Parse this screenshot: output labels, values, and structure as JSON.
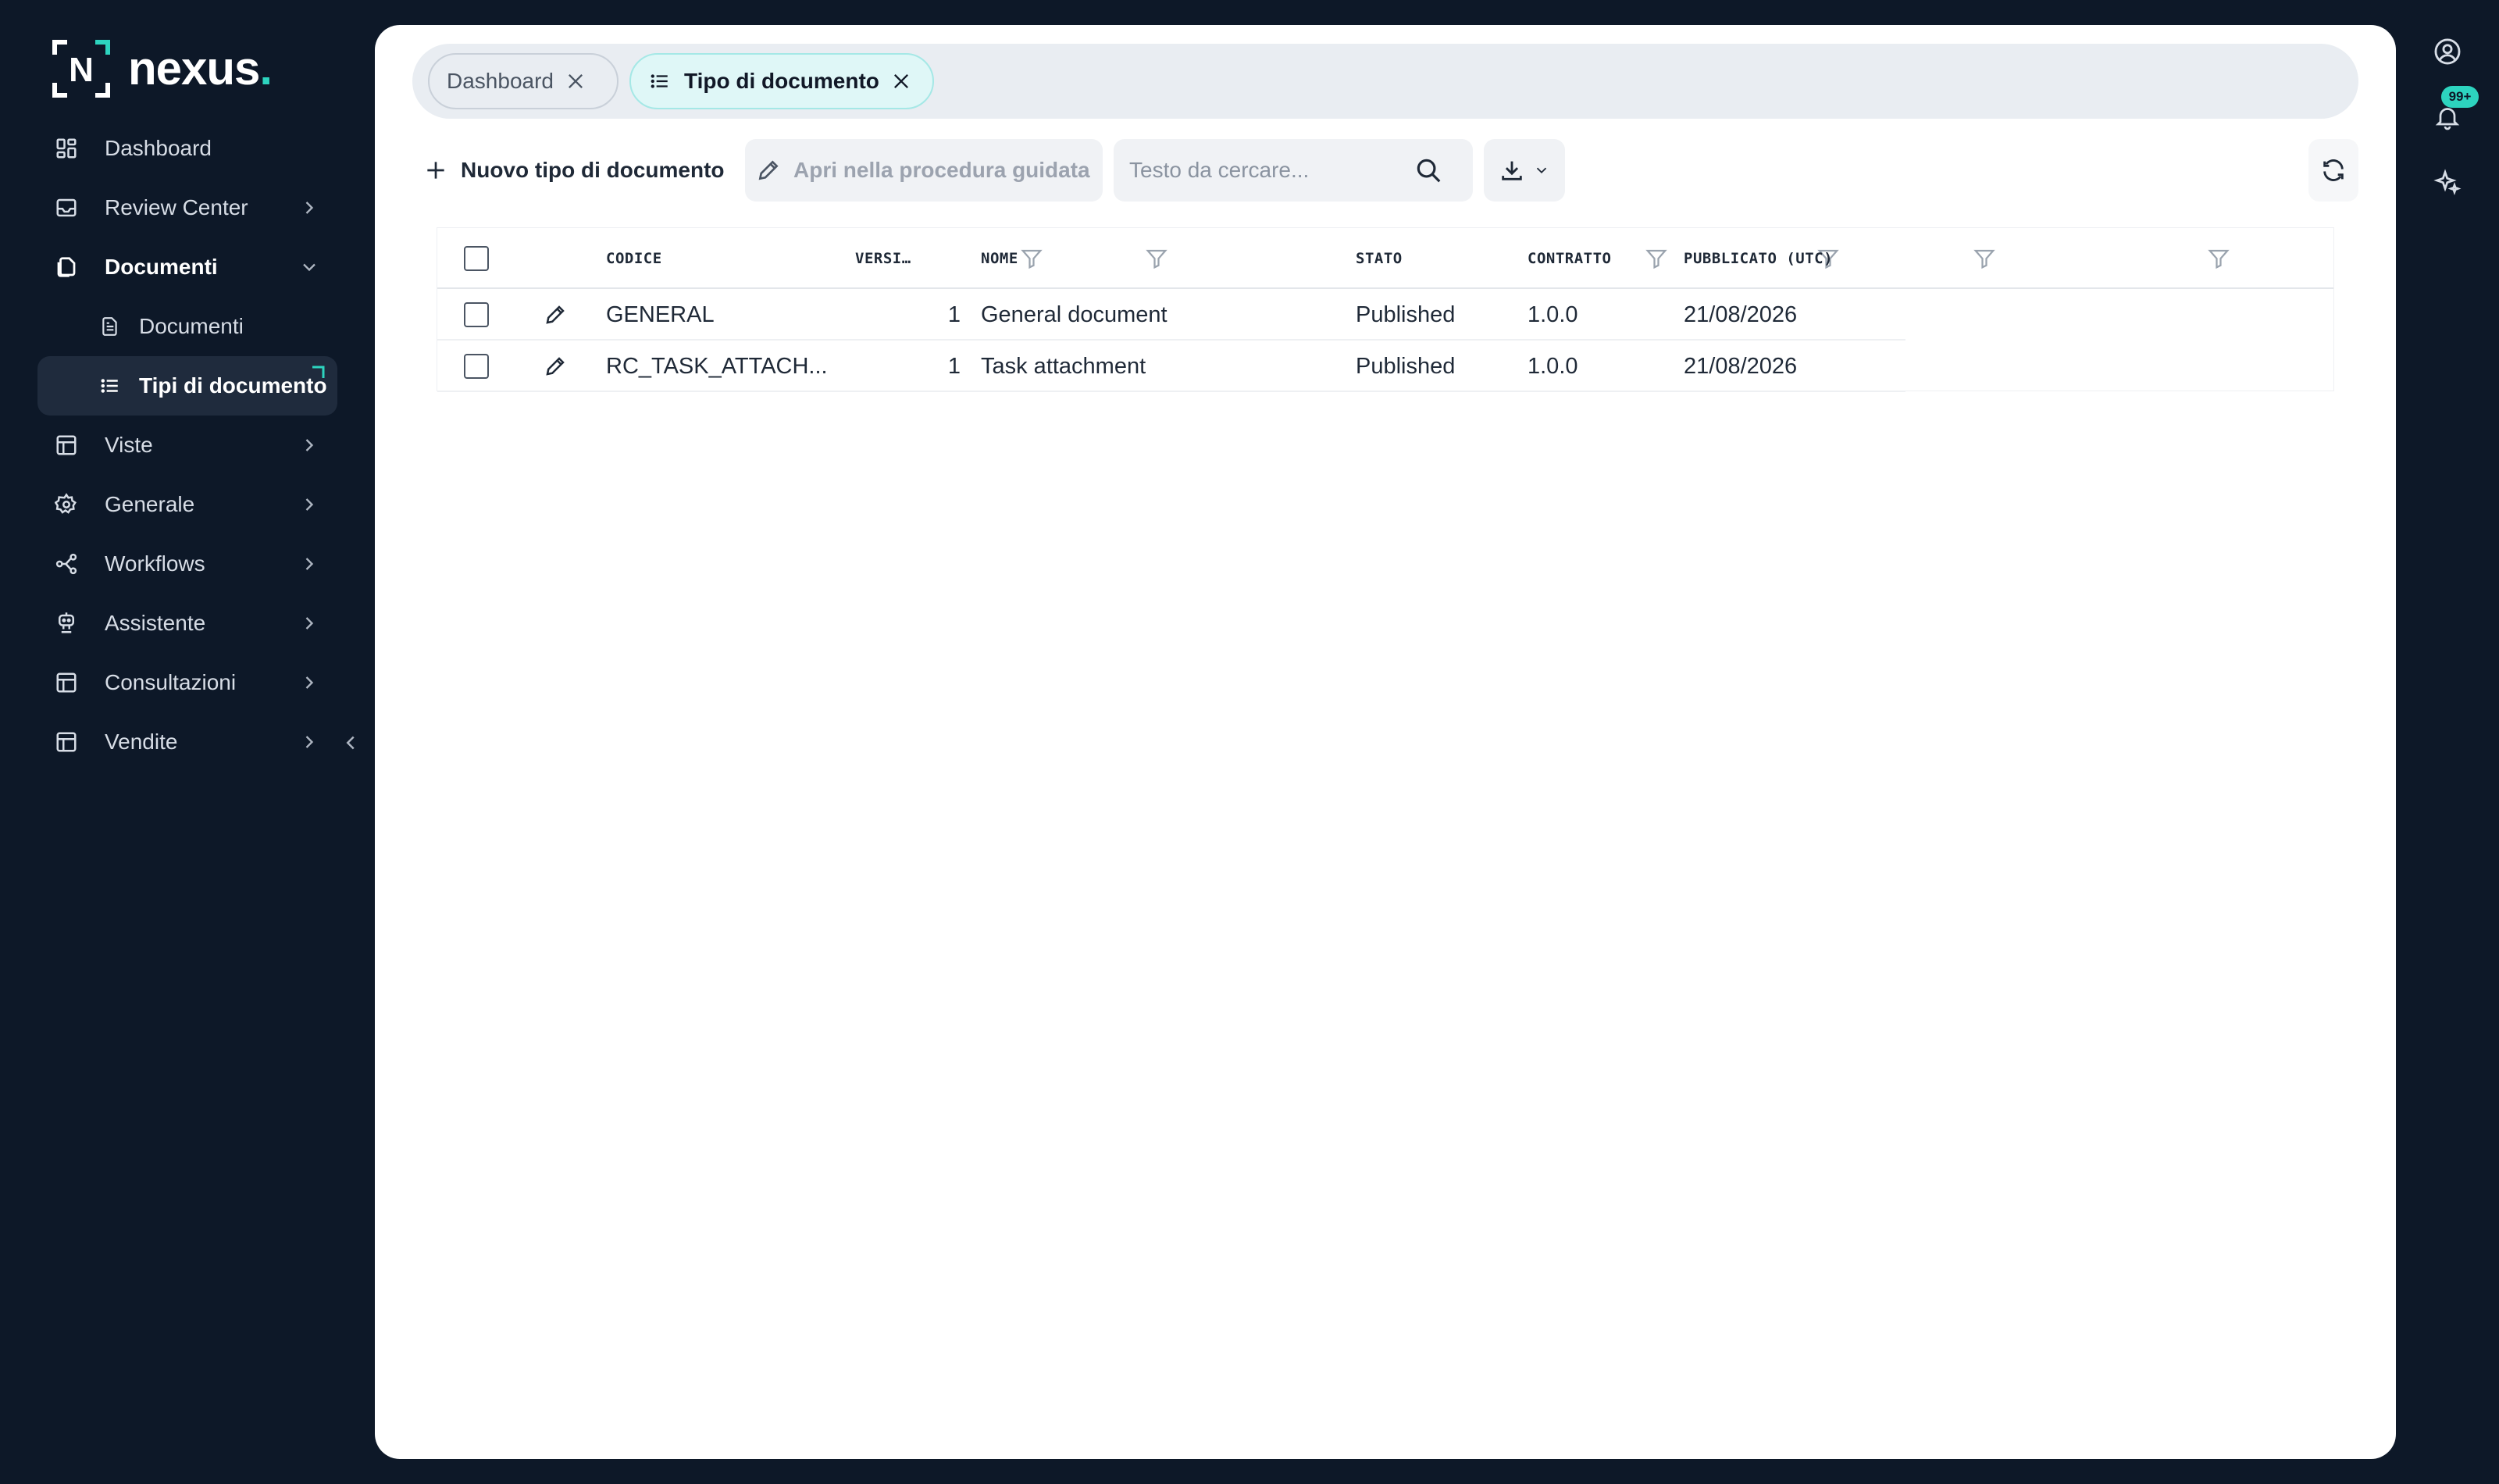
{
  "brand": {
    "name": "nexus",
    "dot": ".",
    "mark_letter": "N",
    "accent": "#2dd4bf"
  },
  "sidebar": {
    "items": [
      {
        "label": "Dashboard",
        "icon": "dashboard-grid-icon",
        "has_chevron": false
      },
      {
        "label": "Review Center",
        "icon": "inbox-icon",
        "has_chevron": true
      },
      {
        "label": "Documenti",
        "icon": "documents-icon",
        "has_chevron": true,
        "expanded": true
      },
      {
        "label": "Viste",
        "icon": "table-icon",
        "has_chevron": true
      },
      {
        "label": "Generale",
        "icon": "gear-icon",
        "has_chevron": true
      },
      {
        "label": "Workflows",
        "icon": "workflow-icon",
        "has_chevron": true
      },
      {
        "label": "Assistente",
        "icon": "robot-icon",
        "has_chevron": true
      },
      {
        "label": "Consultazioni",
        "icon": "table-icon",
        "has_chevron": true
      },
      {
        "label": "Vendite",
        "icon": "table-icon",
        "has_chevron": true
      }
    ],
    "subitems": [
      {
        "label": "Documenti",
        "icon": "file-icon",
        "active": false
      },
      {
        "label": "Tipi di documento",
        "icon": "list-icon",
        "active": true
      }
    ]
  },
  "tabs": [
    {
      "label": "Dashboard",
      "active": false
    },
    {
      "label": "Tipo di documento",
      "active": true
    }
  ],
  "toolbar": {
    "new_label": "Nuovo tipo di documento",
    "wizard_label": "Apri nella procedura guidata",
    "search_placeholder": "Testo da cercare...",
    "search_value": ""
  },
  "table": {
    "columns": [
      "CODICE",
      "VERSI…",
      "NOME",
      "STATO",
      "CONTRATTO",
      "PUBBLICATO (UTC)"
    ],
    "rows": [
      {
        "codice": "GENERAL",
        "versione": "1",
        "nome": "General document",
        "stato": "Published",
        "contratto": "1.0.0",
        "pubblicato": "21/08/2026"
      },
      {
        "codice": "RC_TASK_ATTACH...",
        "versione": "1",
        "nome": "Task attachment",
        "stato": "Published",
        "contratto": "1.0.0",
        "pubblicato": "21/08/2026"
      }
    ]
  },
  "notifications": {
    "badge": "99+"
  },
  "colors": {
    "sidebar_bg": "#0d1828",
    "active_tab_bg": "#dff7f7",
    "accent": "#2dd4bf"
  }
}
